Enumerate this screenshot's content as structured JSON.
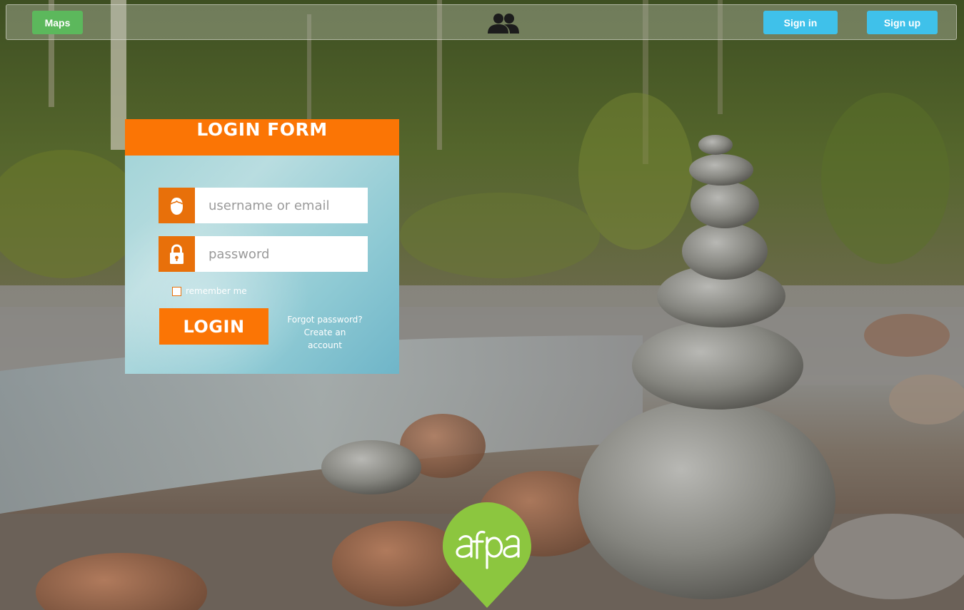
{
  "nav": {
    "maps_label": "Maps",
    "signin_label": "Sign in",
    "signup_label": "Sign up",
    "center_icon": "people-icon"
  },
  "login": {
    "title": "LOGIN FORM",
    "username_placeholder": "username or email",
    "username_icon": "user-icon",
    "password_placeholder": "password",
    "password_icon": "lock-icon",
    "remember_label": "remember me",
    "submit_label": "LOGIN",
    "forgot_label": "Forgot password?",
    "create_label": "Create an account"
  },
  "logo": {
    "text": "afpa"
  },
  "colors": {
    "maps_green": "#5cb85c",
    "auth_blue": "#3fc1ea",
    "login_orange": "#fb7505",
    "afpa_green": "#8cc63f"
  }
}
